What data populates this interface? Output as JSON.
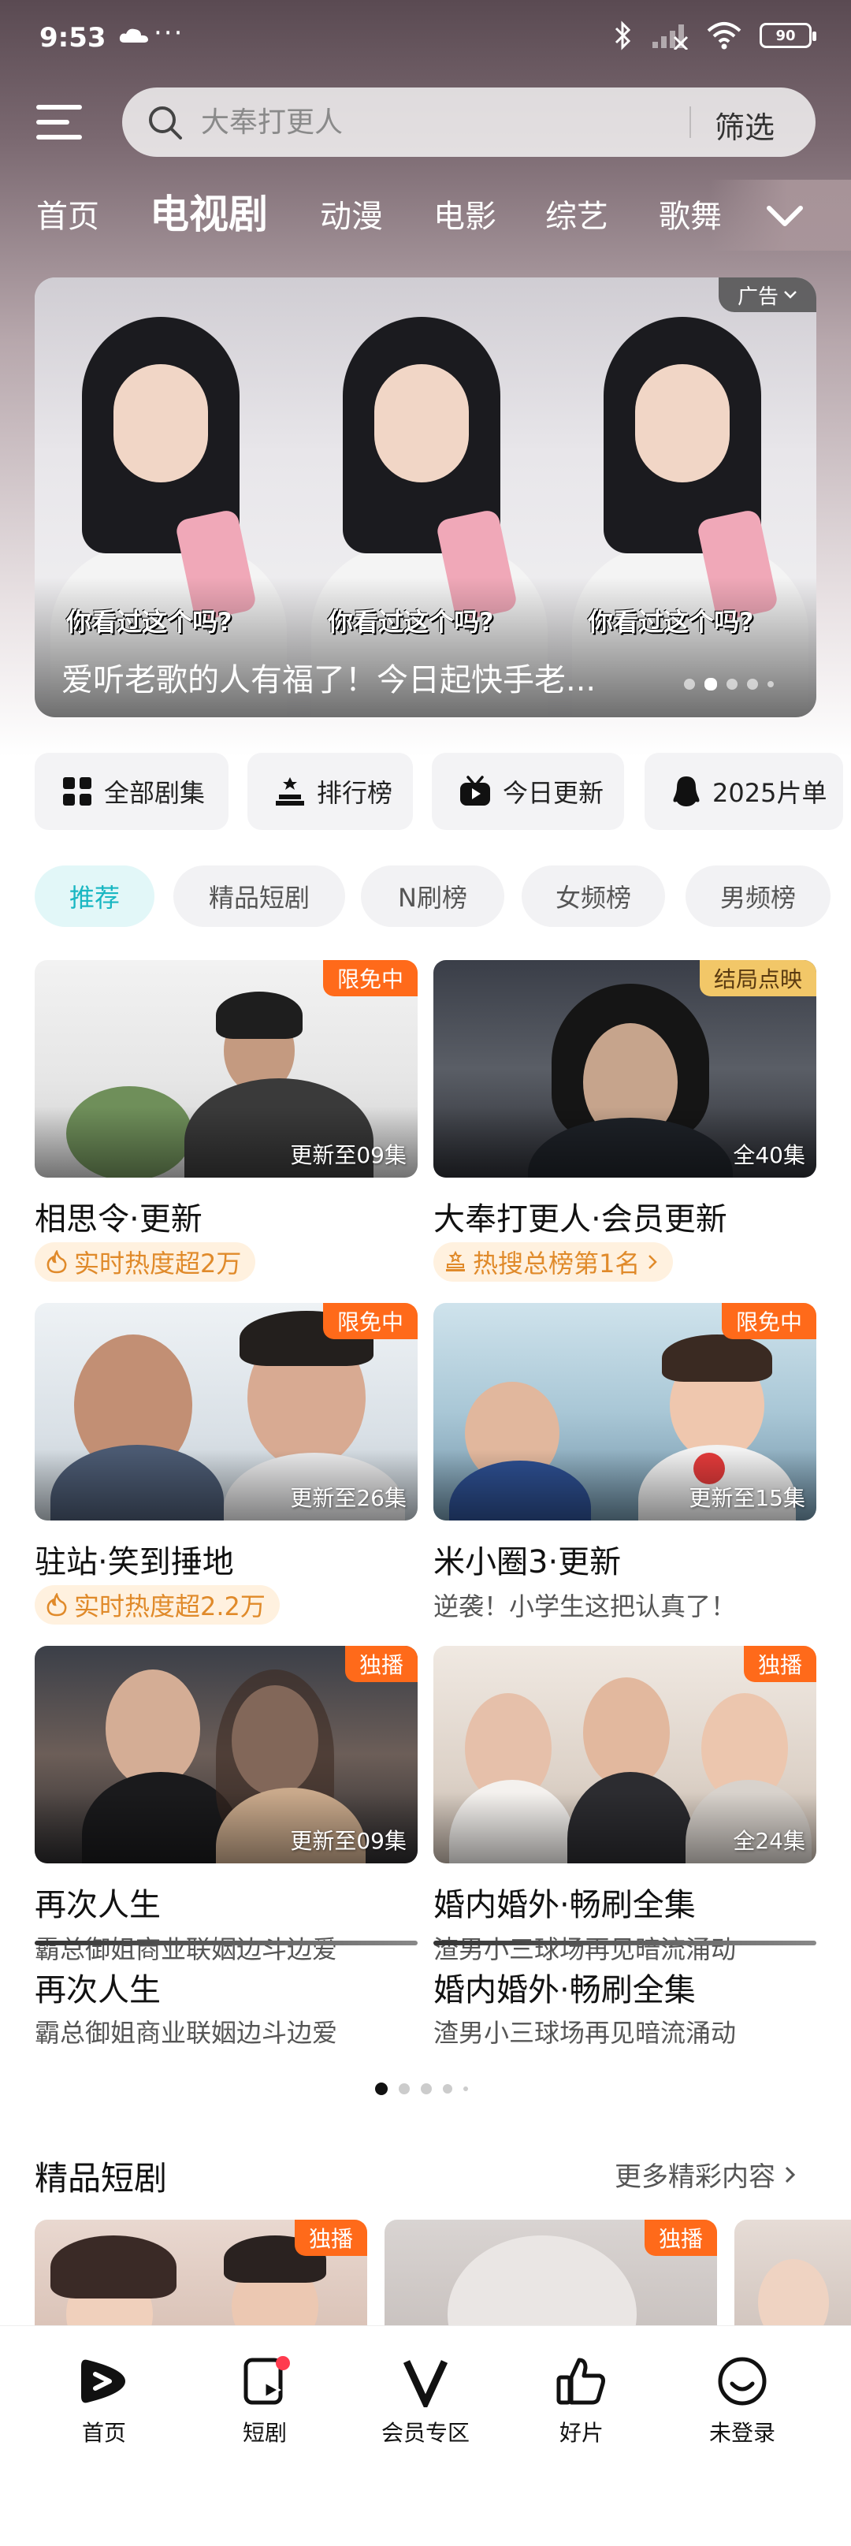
{
  "status_bar": {
    "time": "9:53",
    "dots": "···",
    "battery": "90"
  },
  "search": {
    "placeholder": "大奉打更人",
    "filter_label": "筛选"
  },
  "tabs": [
    {
      "label": "首页"
    },
    {
      "label": "电视剧",
      "active": true
    },
    {
      "label": "动漫"
    },
    {
      "label": "电影"
    },
    {
      "label": "综艺"
    },
    {
      "label": "歌舞"
    }
  ],
  "banner": {
    "ad_label": "广告",
    "captions": [
      "你看过这个吗?",
      "你看过这个吗?",
      "你看过这个吗?"
    ],
    "title": "爱听老歌的人有福了！今日起快手老..."
  },
  "quick_actions": [
    {
      "label": "全部剧集",
      "icon": "grid-icon"
    },
    {
      "label": "排行榜",
      "icon": "podium-icon"
    },
    {
      "label": "今日更新",
      "icon": "tv-icon"
    },
    {
      "label": "2025片单",
      "icon": "penguin-icon"
    }
  ],
  "chips": [
    {
      "label": "推荐",
      "active": true
    },
    {
      "label": "精品短剧"
    },
    {
      "label": "N刷榜"
    },
    {
      "label": "女频榜"
    },
    {
      "label": "男频榜"
    }
  ],
  "cards": [
    {
      "title": "相思令·更新",
      "tag": "限免中",
      "episodes": "更新至09集",
      "sub": "实时热度超2万",
      "sub_type": "heat"
    },
    {
      "title": "大奉打更人·会员更新",
      "tag": "结局点映",
      "episodes": "全40集",
      "sub": "热搜总榜第1名",
      "sub_type": "rank"
    },
    {
      "title": "驻站·笑到捶地",
      "tag": "限免中",
      "episodes": "更新至26集",
      "sub": "实时热度超2.2万",
      "sub_type": "heat"
    },
    {
      "title": "米小圈3·更新",
      "tag": "限免中",
      "episodes": "更新至15集",
      "sub": "逆袭！小学生这把认真了！",
      "sub_type": "plain"
    },
    {
      "title": "再次人生",
      "tag": "独播",
      "episodes": "更新至09集",
      "sub": "霸总御姐商业联姻边斗边爱",
      "sub_type": "plain"
    },
    {
      "title": "婚内婚外·畅刷全集",
      "tag": "独播",
      "episodes": "全24集",
      "sub": "渣男小三球场再见暗流涌动",
      "sub_type": "plain"
    }
  ],
  "section": {
    "title": "精品短剧",
    "more": "更多精彩内容"
  },
  "short_tags": [
    "独播",
    "独播"
  ],
  "bottom_nav": [
    {
      "label": "首页",
      "icon": "play-logo-icon"
    },
    {
      "label": "短剧",
      "icon": "short-play-icon"
    },
    {
      "label": "会员专区",
      "icon": "vip-icon"
    },
    {
      "label": "好片",
      "icon": "thumbs-up-icon"
    },
    {
      "label": "未登录",
      "icon": "smile-icon"
    }
  ]
}
